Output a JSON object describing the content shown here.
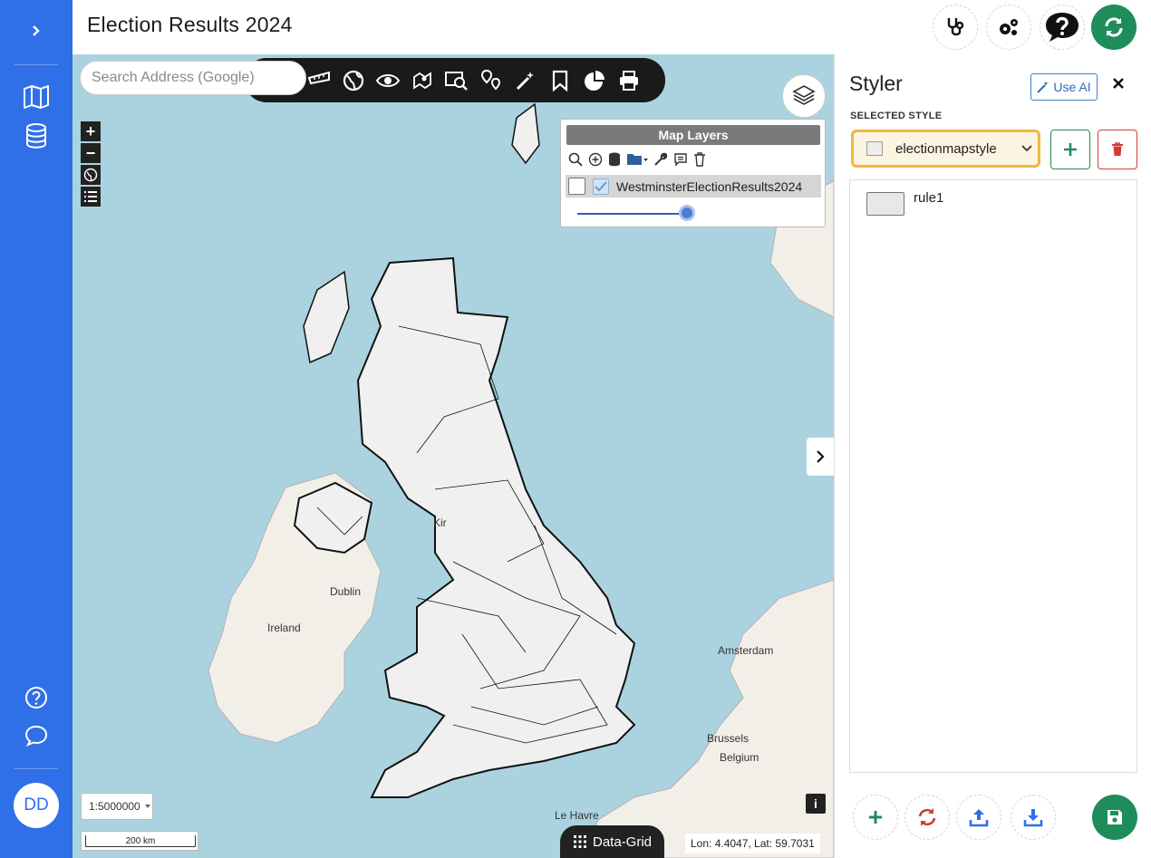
{
  "header": {
    "title": "Election Results 2024"
  },
  "leftnav": {
    "avatar_initials": "DD"
  },
  "map": {
    "search_placeholder": "Search Address (Google)",
    "layers_panel": {
      "title": "Map Layers",
      "layer_name": "WestminsterElectionResults2024"
    },
    "scale_select": "1:5000000",
    "scale_bar": "200 km",
    "data_grid_label": "Data-Grid",
    "coords": "Lon: 4.4047, Lat: 59.7031",
    "info_label": "i",
    "labels": {
      "dublin": "Dublin",
      "ireland": "Ireland",
      "amsterdam": "Amsterdam",
      "brussels": "Brussels",
      "belgium": "Belgium",
      "le_havre": "Le Havre",
      "kir": "Kir"
    }
  },
  "styler": {
    "title": "Styler",
    "use_ai_label": "Use AI",
    "selected_style_label": "SELECTED STYLE",
    "selected_style_value": "electionmapstyle",
    "rules": [
      {
        "name": "rule1"
      }
    ]
  },
  "colors": {
    "nav_blue": "#2f6fe8",
    "green": "#1e8d5a",
    "sea": "#aad3df",
    "highlight": "#f0b73c",
    "danger": "#d23b3b"
  }
}
